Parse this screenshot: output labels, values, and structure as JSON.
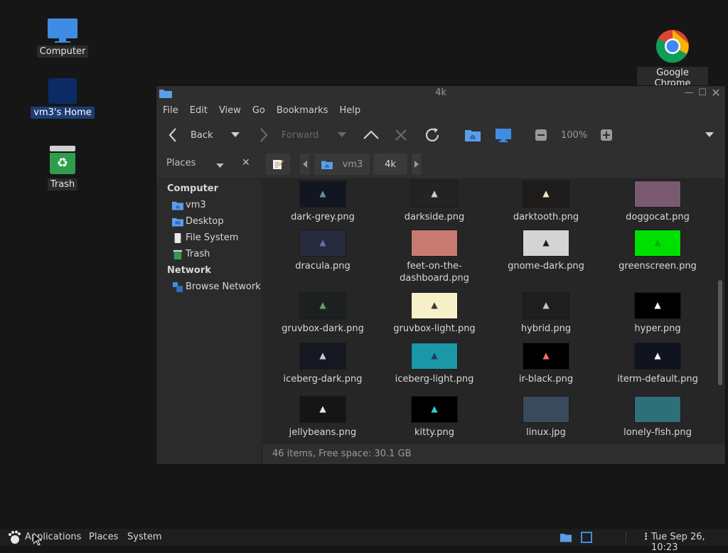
{
  "desktop": {
    "icons": [
      {
        "label": "Computer"
      },
      {
        "label": "vm3's Home"
      },
      {
        "label": "Trash"
      },
      {
        "label": "Google Chrome"
      }
    ]
  },
  "window": {
    "title": "4k",
    "menu": [
      "File",
      "Edit",
      "View",
      "Go",
      "Bookmarks",
      "Help"
    ],
    "toolbar": {
      "back": "Back",
      "forward": "Forward",
      "zoom": "100%"
    },
    "pathbar": {
      "sidebar_header": "Places",
      "segments": [
        "vm3",
        "4k"
      ]
    },
    "sidebar": {
      "sections": [
        {
          "title": "Computer",
          "items": [
            "vm3",
            "Desktop",
            "File System",
            "Trash"
          ]
        },
        {
          "title": "Network",
          "items": [
            "Browse Network"
          ]
        }
      ]
    },
    "files": [
      {
        "name": "dark-grey.png",
        "bg": "#121620",
        "mark": "#6a8aa0"
      },
      {
        "name": "darkside.png",
        "bg": "#222324",
        "mark": "#cfcfcf"
      },
      {
        "name": "darktooth.png",
        "bg": "#1e1c1a",
        "mark": "#f2e5bc"
      },
      {
        "name": "doggocat.png",
        "bg": "#7a5a70",
        "mark": ""
      },
      {
        "name": "dracula.png",
        "bg": "#262a3c",
        "mark": "#6272a4"
      },
      {
        "name": "feet-on-the-dashboard.png",
        "bg": "#c97a70",
        "mark": ""
      },
      {
        "name": "gnome-dark.png",
        "bg": "#d4d4d4",
        "mark": "#1e1e1e"
      },
      {
        "name": "greenscreen.png",
        "bg": "#00e000",
        "mark": "#00b000"
      },
      {
        "name": "gruvbox-dark.png",
        "bg": "#1d2021",
        "mark": "#689d6a"
      },
      {
        "name": "gruvbox-light.png",
        "bg": "#f6efc8",
        "mark": "#3c3836"
      },
      {
        "name": "hybrid.png",
        "bg": "#1d1f21",
        "mark": "#c5c8c6"
      },
      {
        "name": "hyper.png",
        "bg": "#000000",
        "mark": "#ffffff"
      },
      {
        "name": "iceberg-dark.png",
        "bg": "#161821",
        "mark": "#c6c8d1"
      },
      {
        "name": "iceberg-light.png",
        "bg": "#1a98a8",
        "mark": "#1e3a66"
      },
      {
        "name": "ir-black.png",
        "bg": "#000000",
        "mark": "#ff6c60"
      },
      {
        "name": "iterm-default.png",
        "bg": "#101421",
        "mark": "#ffffff"
      },
      {
        "name": "jellybeans.png",
        "bg": "#151515",
        "mark": "#e8e8d3"
      },
      {
        "name": "kitty.png",
        "bg": "#000000",
        "mark": "#33cccc"
      },
      {
        "name": "linux.jpg",
        "bg": "#3a4a5c",
        "mark": ""
      },
      {
        "name": "lonely-fish.png",
        "bg": "#2f6f7a",
        "mark": ""
      }
    ],
    "status": "46 items, Free space: 30.1 GB"
  },
  "panel": {
    "menus": [
      "Applications",
      "Places",
      "System"
    ],
    "clock": "Tue Sep 26, 10:23"
  },
  "colors": {
    "accent": "#3f8de3",
    "desktop_bg": "#161616",
    "selection": "#1d3d73"
  }
}
